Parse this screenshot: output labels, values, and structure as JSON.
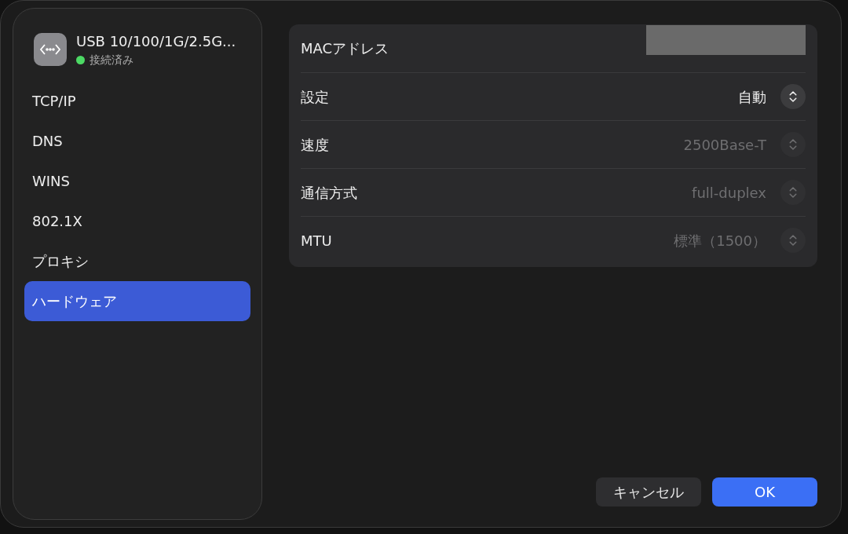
{
  "device": {
    "name": "USB 10/100/1G/2.5G...",
    "status": "接続済み",
    "connected": true
  },
  "sidebar": {
    "items": [
      {
        "label": "TCP/IP",
        "selected": false
      },
      {
        "label": "DNS",
        "selected": false
      },
      {
        "label": "WINS",
        "selected": false
      },
      {
        "label": "802.1X",
        "selected": false
      },
      {
        "label": "プロキシ",
        "selected": false
      },
      {
        "label": "ハードウェア",
        "selected": true
      }
    ]
  },
  "rows": [
    {
      "kind": "redacted",
      "label": "MACアドレス"
    },
    {
      "kind": "popup",
      "label": "設定",
      "value": "自動",
      "disabled": false
    },
    {
      "kind": "popup",
      "label": "速度",
      "value": "2500Base-T",
      "disabled": true
    },
    {
      "kind": "popup",
      "label": "通信方式",
      "value": "full-duplex",
      "disabled": true
    },
    {
      "kind": "popup",
      "label": "MTU",
      "value": "標準（1500）",
      "disabled": true
    }
  ],
  "buttons": [
    {
      "label": "キャンセル",
      "kind": "secondary"
    },
    {
      "label": "OK",
      "kind": "primary"
    }
  ]
}
